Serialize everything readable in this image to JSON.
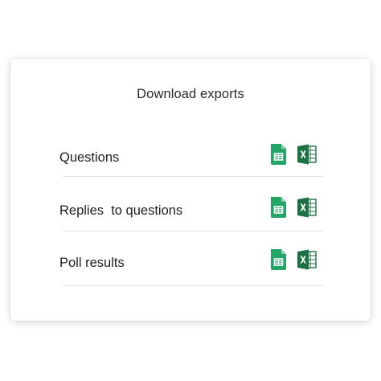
{
  "panel": {
    "title": "Download exports"
  },
  "exports": [
    {
      "label": "Questions",
      "sheets_icon": "google-sheets-icon",
      "excel_icon": "microsoft-excel-icon"
    },
    {
      "label": "Replies  to questions",
      "sheets_icon": "google-sheets-icon",
      "excel_icon": "microsoft-excel-icon"
    },
    {
      "label": "Poll results",
      "sheets_icon": "google-sheets-icon",
      "excel_icon": "microsoft-excel-icon"
    }
  ],
  "colors": {
    "sheets_green": "#23a566",
    "excel_green": "#1d7044",
    "divider": "#e3e3e3"
  }
}
